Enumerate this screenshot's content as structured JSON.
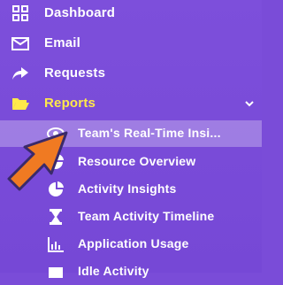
{
  "sidebar": {
    "items": [
      {
        "label": "Dashboard",
        "icon": "dashboard-icon"
      },
      {
        "label": "Email",
        "icon": "envelope-icon"
      },
      {
        "label": "Requests",
        "icon": "share-arrow-icon"
      },
      {
        "label": "Reports",
        "icon": "folder-open-icon",
        "expanded": true
      }
    ],
    "sub_items": [
      {
        "label": "Team's Real-Time Insi...",
        "icon": "eye-icon",
        "active": true
      },
      {
        "label": "Resource Overview",
        "icon": "pie-chart-icon"
      },
      {
        "label": "Activity Insights",
        "icon": "pie-chart-icon"
      },
      {
        "label": "Team Activity Timeline",
        "icon": "hourglass-icon"
      },
      {
        "label": "Application Usage",
        "icon": "bar-chart-icon"
      },
      {
        "label": "Idle Activity",
        "icon": "box-icon"
      }
    ]
  },
  "colors": {
    "background": "#7a4cd8",
    "reports_highlight": "#ffe94a",
    "pointer_arrow": "#f07a22",
    "icon_color": "#ffffff"
  }
}
